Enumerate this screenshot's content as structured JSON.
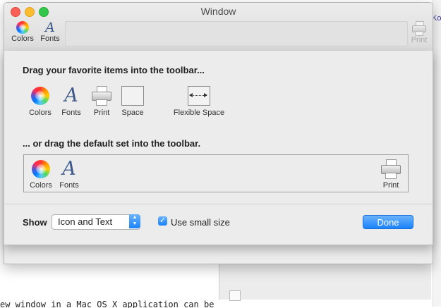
{
  "window": {
    "title": "Window"
  },
  "toolbar": {
    "colors_label": "Colors",
    "fonts_label": "Fonts",
    "print_label": "Print"
  },
  "sheet": {
    "palette_heading": "Drag your favorite items into the toolbar...",
    "palette_items": [
      {
        "label": "Colors",
        "icon": "color-wheel-icon"
      },
      {
        "label": "Fonts",
        "icon": "font-icon"
      },
      {
        "label": "Print",
        "icon": "printer-icon"
      },
      {
        "label": "Space",
        "icon": "space-icon"
      },
      {
        "label": "Flexible Space",
        "icon": "flexible-space-icon"
      }
    ],
    "default_heading": "... or drag the default set into the toolbar.",
    "default_items": [
      {
        "label": "Colors",
        "icon": "color-wheel-icon"
      },
      {
        "label": "Fonts",
        "icon": "font-icon"
      },
      {
        "label": "Print",
        "icon": "printer-icon"
      }
    ],
    "show_label": "Show",
    "show_value": "Icon and Text",
    "small_size_label": "Use small size",
    "small_size_checked": true,
    "done_label": "Done"
  },
  "background": {
    "right_text": "Ko",
    "bottom_text": "ew window in a Mac OS X application can be"
  },
  "colors": {
    "accent": "#1a82fb",
    "close": "#fc5f57",
    "minimize": "#fdbc2e",
    "maximize": "#34c84a"
  }
}
